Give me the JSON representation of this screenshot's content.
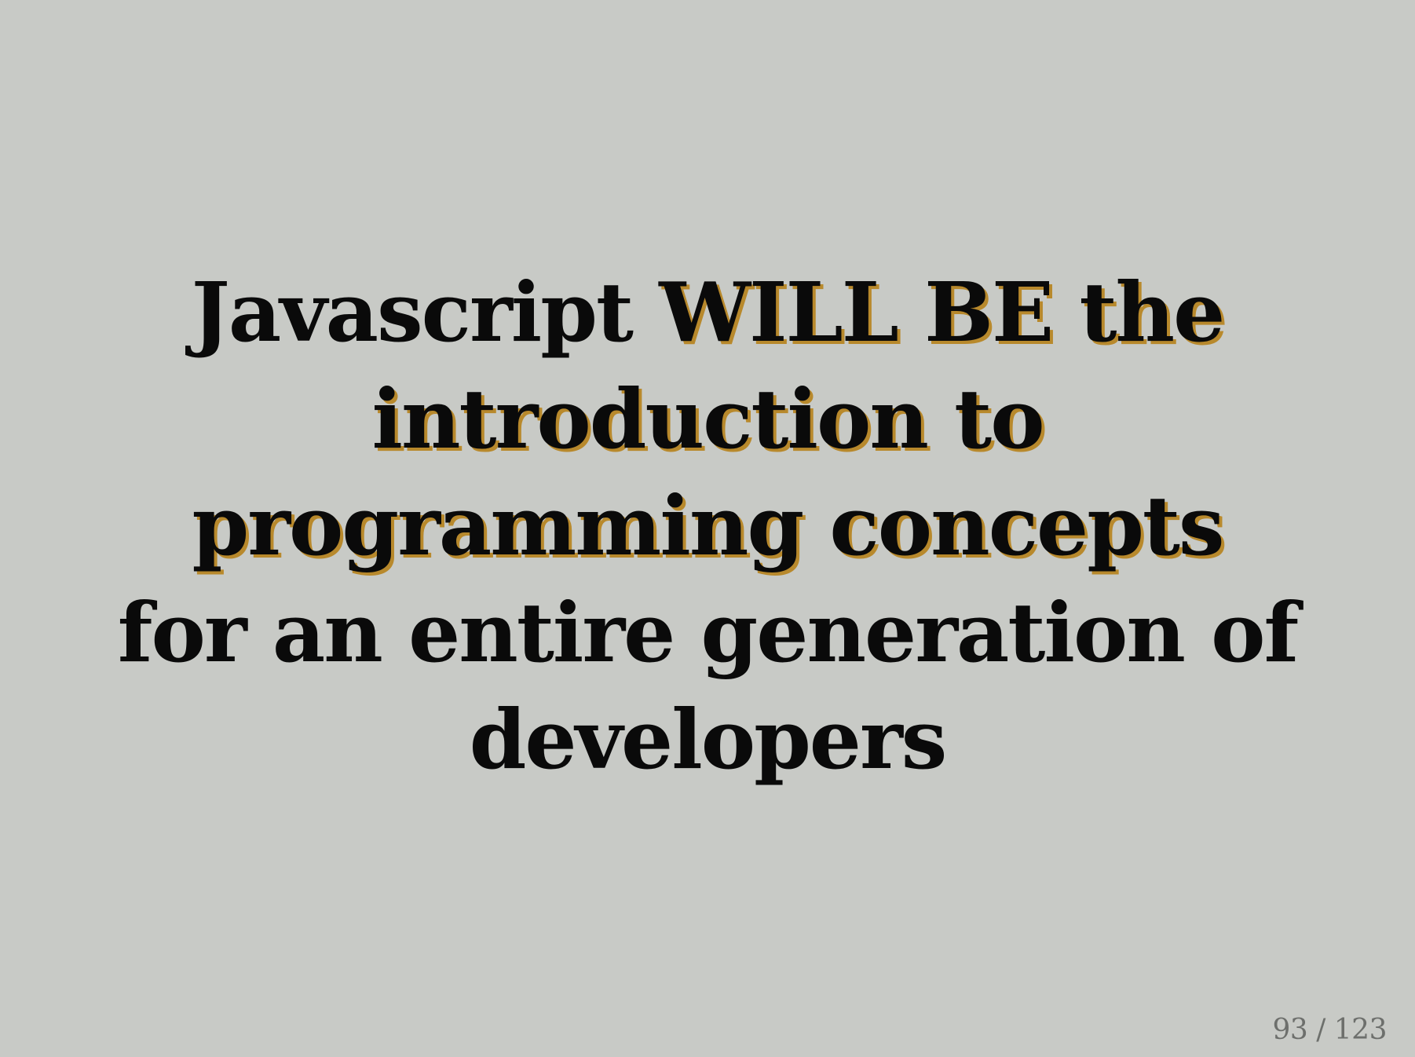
{
  "slide": {
    "lines": [
      {
        "plain": "Javascript ",
        "highlight": "WILL BE the"
      },
      {
        "plain": "",
        "highlight": "introduction to"
      },
      {
        "plain": "",
        "highlight": "programming concepts"
      },
      {
        "plain": "for an entire generation of",
        "highlight": ""
      },
      {
        "plain": "developers",
        "highlight": ""
      }
    ],
    "highlight_shadow_color": "#b8892c",
    "background_color": "#c8cac6",
    "text_color": "#0a0a0a"
  },
  "pager": {
    "label": "93 / 123",
    "current": 93,
    "total": 123
  }
}
